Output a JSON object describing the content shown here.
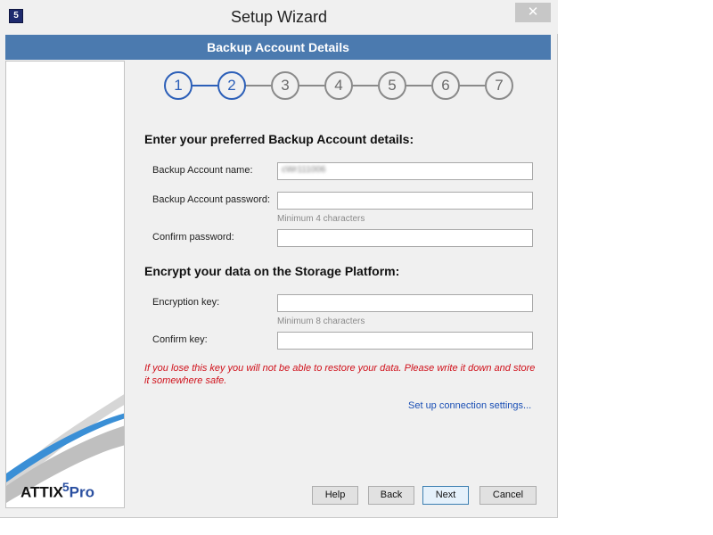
{
  "window": {
    "title": "Setup Wizard",
    "close_glyph": "✕",
    "app_icon_glyph": "5"
  },
  "header": {
    "title": "Backup Account Details"
  },
  "steps": {
    "items": [
      "1",
      "2",
      "3",
      "4",
      "5",
      "6",
      "7"
    ],
    "current": 2,
    "active_color": "#2c5fb8",
    "inactive_color": "#8a8a8a"
  },
  "account_section": {
    "title": "Enter your preferred Backup Account details:",
    "name_label": "Backup Account name:",
    "name_value": "cWr111006",
    "password_label": "Backup Account password:",
    "password_hint": "Minimum 4 characters",
    "confirm_label": "Confirm password:"
  },
  "encrypt_section": {
    "title": "Encrypt your data on the Storage Platform:",
    "key_label": "Encryption key:",
    "key_hint": "Minimum 8 characters",
    "confirm_label": "Confirm key:"
  },
  "warning": "If you lose this key you will not be able to restore your data. Please write it down and store it somewhere safe.",
  "connection_link": "Set up connection settings...",
  "buttons": {
    "help": "Help",
    "back": "Back",
    "next": "Next",
    "cancel": "Cancel"
  },
  "logo": {
    "text": "ATTIX",
    "sup": "5",
    "suffix": "Pro"
  },
  "colors": {
    "header_band": "#4b7aaf",
    "warning": "#d0101a",
    "link": "#1a4fb5"
  }
}
